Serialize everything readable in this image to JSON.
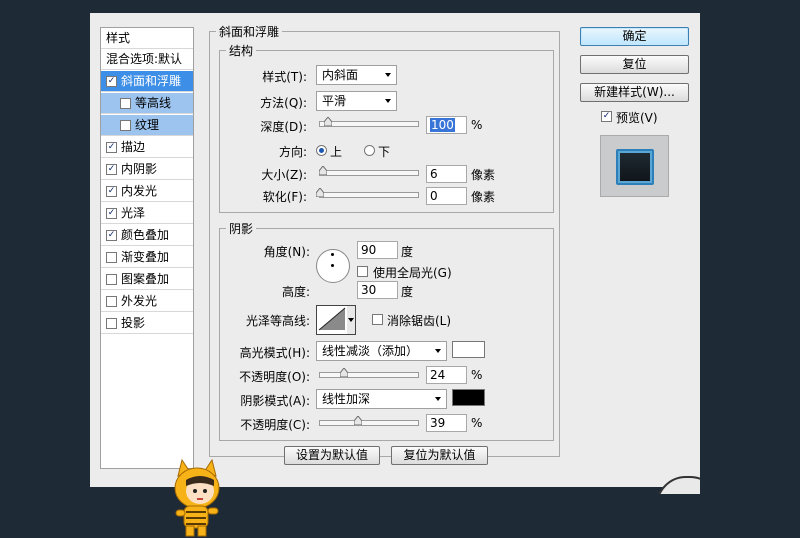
{
  "style_list": {
    "header": "样式",
    "blend_item": "混合选项:默认",
    "items": [
      {
        "label": "斜面和浮雕",
        "checked": "✓",
        "selected": true,
        "sub": false
      },
      {
        "label": "等高线",
        "checked": "",
        "selected": false,
        "sub": true
      },
      {
        "label": "纹理",
        "checked": "",
        "selected": false,
        "sub": true
      },
      {
        "label": "描边",
        "checked": "✓",
        "selected": false,
        "sub": false
      },
      {
        "label": "内阴影",
        "checked": "✓",
        "selected": false,
        "sub": false
      },
      {
        "label": "内发光",
        "checked": "✓",
        "selected": false,
        "sub": false
      },
      {
        "label": "光泽",
        "checked": "✓",
        "selected": false,
        "sub": false
      },
      {
        "label": "颜色叠加",
        "checked": "✓",
        "selected": false,
        "sub": false
      },
      {
        "label": "渐变叠加",
        "checked": "",
        "selected": false,
        "sub": false
      },
      {
        "label": "图案叠加",
        "checked": "",
        "selected": false,
        "sub": false
      },
      {
        "label": "外发光",
        "checked": "",
        "selected": false,
        "sub": false
      },
      {
        "label": "投影",
        "checked": "",
        "selected": false,
        "sub": false
      }
    ]
  },
  "bevel": {
    "group_title": "斜面和浮雕",
    "structure": {
      "title": "结构",
      "style_label": "样式(T):",
      "style_value": "内斜面",
      "technique_label": "方法(Q):",
      "technique_value": "平滑",
      "depth_label": "深度(D):",
      "depth_value": "100",
      "depth_unit": "%",
      "direction_label": "方向:",
      "direction_up": "上",
      "direction_down": "下",
      "size_label": "大小(Z):",
      "size_value": "6",
      "size_unit": "像素",
      "soften_label": "软化(F):",
      "soften_value": "0",
      "soften_unit": "像素"
    },
    "shading": {
      "title": "阴影",
      "angle_label": "角度(N):",
      "angle_value": "90",
      "angle_unit": "度",
      "global_light_label": "使用全局光(G)",
      "altitude_label": "高度:",
      "altitude_value": "30",
      "altitude_unit": "度",
      "gloss_label": "光泽等高线:",
      "antialias_label": "消除锯齿(L)",
      "highlight_mode_label": "高光模式(H):",
      "highlight_mode_value": "线性减淡（添加）",
      "highlight_color": "#ffffff",
      "highlight_opacity_label": "不透明度(O):",
      "highlight_opacity_value": "24",
      "shadow_mode_label": "阴影模式(A):",
      "shadow_mode_value": "线性加深",
      "shadow_color": "#000000",
      "shadow_opacity_label": "不透明度(C):",
      "shadow_opacity_value": "39",
      "percent": "%"
    },
    "make_default": "设置为默认值",
    "reset_default": "复位为默认值"
  },
  "side": {
    "ok": "确定",
    "reset": "复位",
    "new_style": "新建样式(W)...",
    "preview_label": "预览(V)",
    "preview_checked": "✓"
  }
}
